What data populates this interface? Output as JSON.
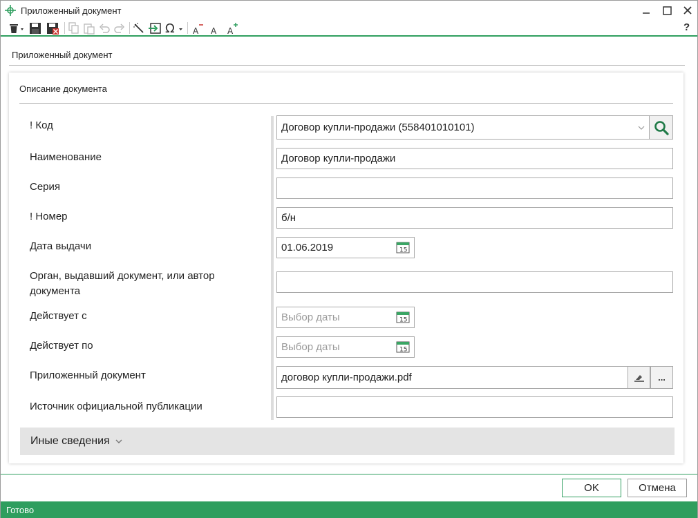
{
  "window": {
    "title": "Приложенный документ"
  },
  "toolbar": {
    "help_label": "?",
    "buttons": [
      "delete-icon",
      "save-icon",
      "save-close-icon",
      "copy-icon",
      "paste-icon",
      "undo-icon",
      "redo-icon",
      "wand-icon",
      "insert-icon",
      "omega-icon",
      "font-decrease-icon",
      "font-reset-icon",
      "font-increase-icon"
    ]
  },
  "page": {
    "header": "Приложенный документ"
  },
  "card": {
    "title": "Описание документа",
    "fields": {
      "code": {
        "label": "! Код",
        "value": "Договор купли-продажи (558401010101)"
      },
      "name": {
        "label": "Наименование",
        "value": "Договор купли-продажи"
      },
      "series": {
        "label": "Серия",
        "value": ""
      },
      "number": {
        "label": "! Номер",
        "value": "б/н"
      },
      "issue_date": {
        "label": "Дата выдачи",
        "value": "01.06.2019"
      },
      "issuer": {
        "label": "Орган, выдавший документ, или автор документа",
        "value": ""
      },
      "valid_from": {
        "label": "Действует с",
        "placeholder": "Выбор даты"
      },
      "valid_to": {
        "label": "Действует по",
        "placeholder": "Выбор даты"
      },
      "attached": {
        "label": "Приложенный документ",
        "value": "договор купли-продажи.pdf",
        "browse_label": "..."
      },
      "source": {
        "label": "Источник официальной публикации",
        "value": ""
      }
    },
    "calendar_day": "15",
    "other_info": "Иные сведения"
  },
  "buttons": {
    "ok": "OK",
    "cancel": "Отмена"
  },
  "status": {
    "text": "Готово"
  },
  "colors": {
    "accent": "#2e9e5e"
  }
}
